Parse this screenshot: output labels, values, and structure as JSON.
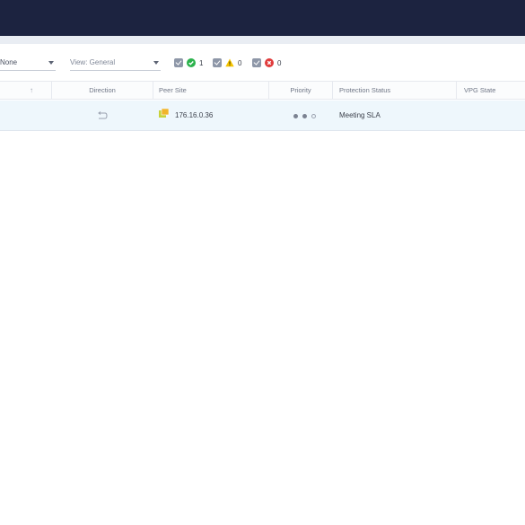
{
  "toolbar": {
    "group_by_value": "None",
    "view_value": "View: General",
    "filters": {
      "ok_count": "1",
      "warning_count": "0",
      "error_count": "0"
    }
  },
  "table": {
    "columns": [
      "Direction",
      "Peer Site",
      "Priority",
      "Protection Status",
      "VPG State"
    ],
    "rows": [
      {
        "direction_icon": "return-arrow-icon",
        "peer_site": "176.16.0.36",
        "priority": {
          "filled": 2,
          "total": 3
        },
        "protection_status": "Meeting SLA",
        "vpg_state": ""
      }
    ]
  },
  "colors": {
    "topbar": "#1c2340",
    "ok": "#2bb24c",
    "warning": "#f5c400",
    "error": "#e03b3b",
    "row_selected": "#eef7fc"
  }
}
